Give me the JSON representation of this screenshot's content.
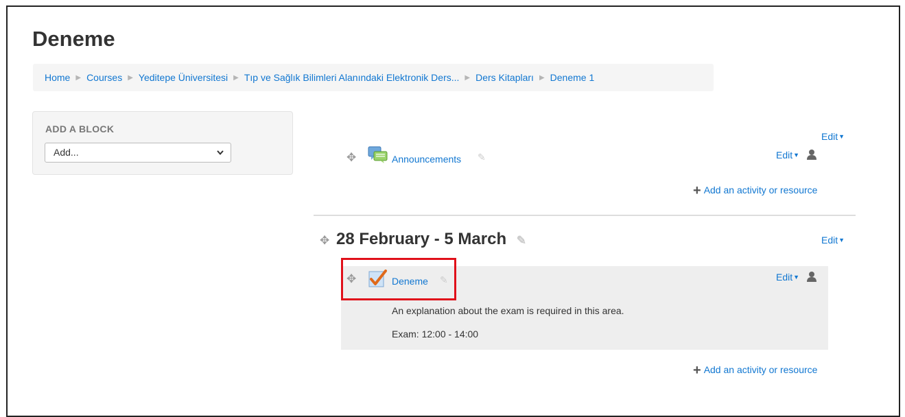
{
  "page": {
    "title": "Deneme"
  },
  "breadcrumb": [
    "Home",
    "Courses",
    "Yeditepe Üniversitesi",
    "Tıp ve Sağlık Bilimleri Alanındaki Elektronik Ders...",
    "Ders Kitapları",
    "Deneme 1"
  ],
  "block": {
    "title": "ADD A BLOCK",
    "select_value": "Add..."
  },
  "section0": {
    "edit_label": "Edit",
    "activity": {
      "name": "Announcements",
      "icon": "forum-icon",
      "edit_label": "Edit"
    },
    "add_label": "Add an activity or resource"
  },
  "section1": {
    "title": "28 February - 5 March",
    "edit_label": "Edit",
    "activity": {
      "name": "Deneme",
      "icon": "quiz-icon",
      "edit_label": "Edit",
      "description": "An explanation about the exam is required in this area.",
      "exam_time": "Exam: 12:00 - 14:00"
    },
    "add_label": "Add an activity or resource"
  },
  "colors": {
    "link": "#1177d1",
    "highlight": "#e0101a"
  }
}
